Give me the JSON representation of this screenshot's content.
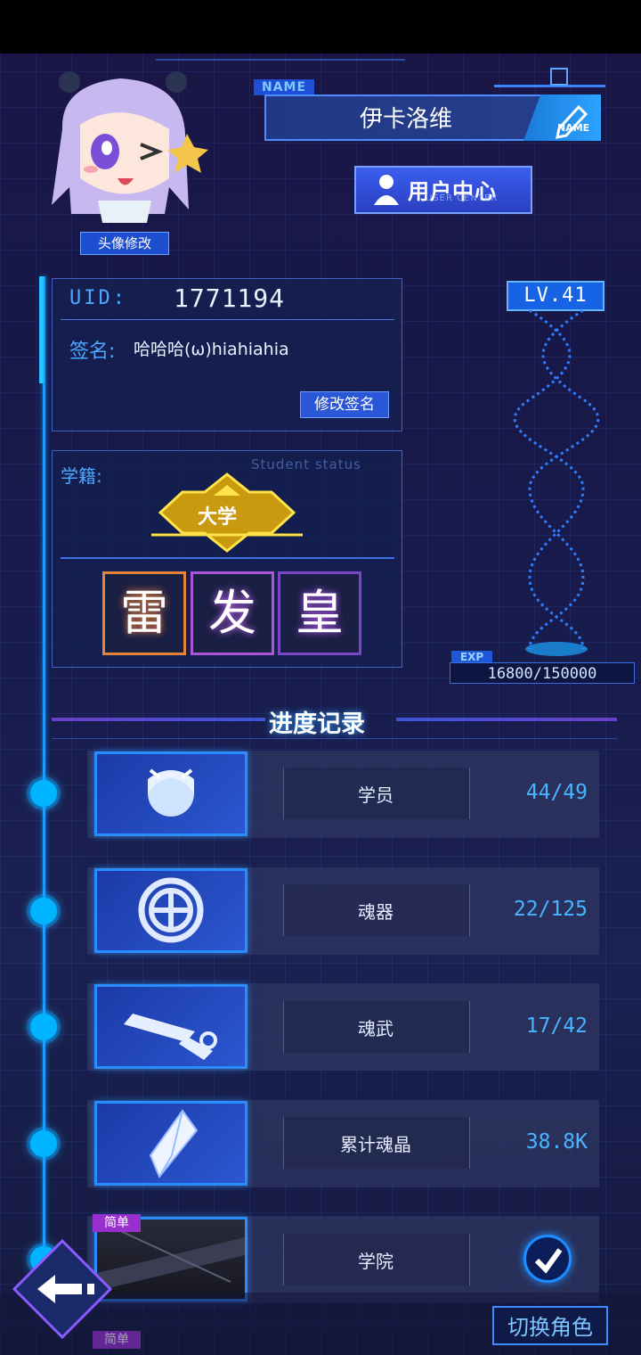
{
  "header": {
    "name_tag": "NAME",
    "player_name": "伊卡洛维",
    "name_edit_label": "NAME",
    "avatar_button": "头像修改",
    "user_center": "用户中心",
    "user_center_sub": "USER CENTER"
  },
  "profile": {
    "uid_label": "UID:",
    "uid_value": "1771194",
    "signature_label": "签名:",
    "signature_value": "哈哈哈(ω)hiahiahia",
    "edit_signature": "修改签名"
  },
  "student_status": {
    "label": "学籍:",
    "label_en": "Student status",
    "rank": "大学",
    "title_chars": [
      "雷",
      "发",
      "皇"
    ]
  },
  "level": {
    "level_text": "LV.41",
    "exp_label": "EXP",
    "exp_text": "16800/150000",
    "exp_fraction": 0.112
  },
  "progress": {
    "title": "进度记录",
    "rows": [
      {
        "label": "学员",
        "value": "44/49",
        "icon": "student-icon"
      },
      {
        "label": "魂器",
        "value": "22/125",
        "icon": "soul-device-icon"
      },
      {
        "label": "魂武",
        "value": "17/42",
        "icon": "chainsaw-weapon-icon"
      },
      {
        "label": "累计魂晶",
        "value": "38.8K",
        "icon": "crystal-icon"
      },
      {
        "label": "学院",
        "value": "",
        "icon": "academy-icon",
        "tag": "简单"
      }
    ],
    "next_tag": "简单"
  },
  "footer": {
    "switch_role": "切换角色"
  },
  "colors": {
    "accent": "#1e9aff",
    "panel_border": "#3f63c6",
    "easy_tag": "#9a2fd0"
  }
}
